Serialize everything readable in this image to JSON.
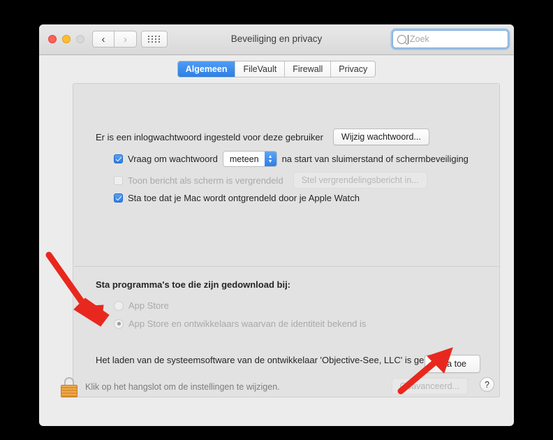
{
  "window": {
    "title": "Beveiliging en privacy",
    "traffic_lights": [
      "close",
      "minimize",
      "zoom"
    ],
    "nav": {
      "back": "‹",
      "forward": "›",
      "grid": "grid-icon"
    },
    "search": {
      "placeholder": "Zoek",
      "value": ""
    }
  },
  "tabs": [
    {
      "label": "Algemeen",
      "active": true
    },
    {
      "label": "FileVault",
      "active": false
    },
    {
      "label": "Firewall",
      "active": false
    },
    {
      "label": "Privacy",
      "active": false
    }
  ],
  "general": {
    "password_status": "Er is een inlogwachtwoord ingesteld voor deze gebruiker",
    "change_password_button": "Wijzig wachtwoord...",
    "require_password_prefix": "Vraag om wachtwoord",
    "require_password_delay": "meteen",
    "require_password_suffix": "na start van sluimerstand of schermbeveiliging",
    "show_message_label": "Toon bericht als scherm is vergrendeld",
    "set_lock_message_button": "Stel vergrendelingsbericht in...",
    "apple_watch_label": "Sta toe dat je Mac wordt ontgrendeld door je Apple Watch"
  },
  "download_section": {
    "heading": "Sta programma's toe die zijn gedownload bij:",
    "options": [
      {
        "label": "App Store",
        "selected": false
      },
      {
        "label": "App Store en ontwikkelaars waarvan de identiteit bekend is",
        "selected": true
      }
    ]
  },
  "blocked_software": {
    "message": "Het laden van de systeemsoftware van de ontwikkelaar 'Objective-See, LLC' is geblokkeerd.",
    "allow_button": "Sta toe"
  },
  "bottom_bar": {
    "lock_icon": "lock-closed-icon",
    "lock_message": "Klik op het hangslot om de instellingen te wijzigen.",
    "advanced_button": "Geavanceerd...",
    "help_button": "?"
  },
  "annotations": {
    "arrow_color": "#e8281e",
    "arrows": [
      {
        "name": "arrow-to-blocked-message",
        "from": "top-left",
        "to": "bottom-right"
      },
      {
        "name": "arrow-to-allow-button",
        "from": "bottom-left",
        "to": "top-right"
      }
    ]
  }
}
